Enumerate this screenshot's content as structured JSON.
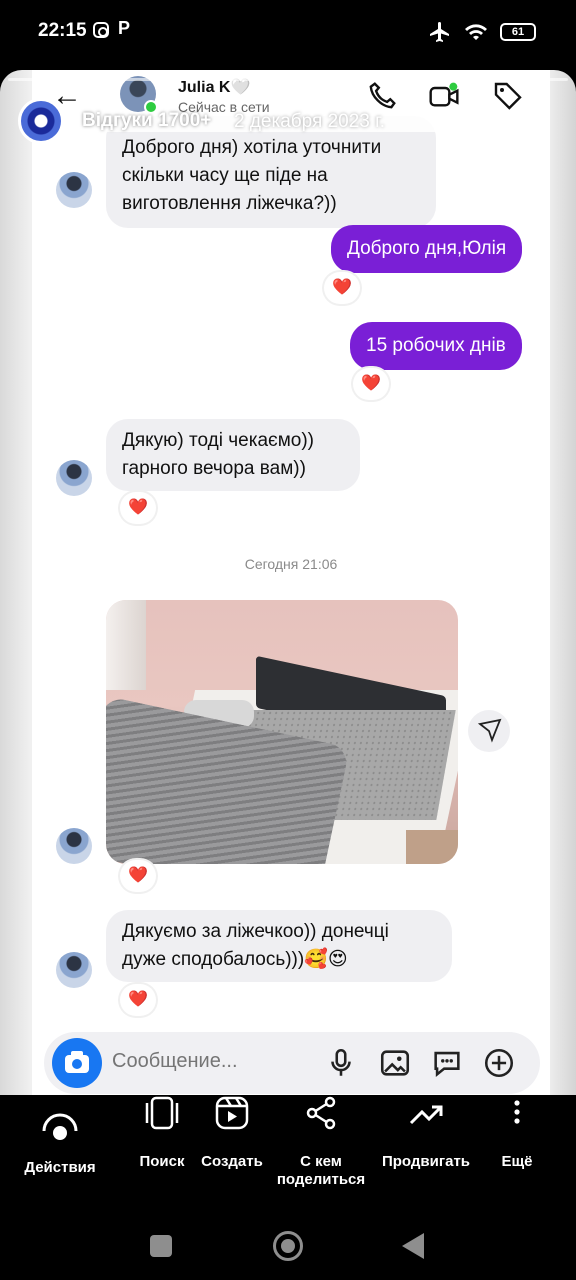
{
  "status_bar": {
    "time": "22:15",
    "battery": "61"
  },
  "story": {
    "title": "Відгуки 1700+",
    "date": "2 декабря 2023 г."
  },
  "chat": {
    "contact_name": "Julia K🤍",
    "contact_status": "Сейчас в сети",
    "messages": [
      {
        "direction": "incoming",
        "text": "Доброго дня) хотіла уточнити скільки часу ще піде на виготовлення ліжечка?))"
      },
      {
        "direction": "outgoing",
        "text": "Доброго дня,Юлія",
        "reaction": "❤️"
      },
      {
        "direction": "outgoing",
        "text": "15 робочих днів",
        "reaction": "❤️"
      },
      {
        "direction": "incoming",
        "text": "Дякую) тоді чекаємо)) гарного вечора вам))",
        "reaction": "❤️"
      },
      {
        "direction": "incoming",
        "type": "photo",
        "reaction": "❤️"
      },
      {
        "direction": "incoming",
        "text": "Дякуємо за ліжечкоо)) донечці дуже сподобалось)))🥰😍",
        "reaction": "❤️"
      }
    ],
    "timestamp": "Сегодня 21:06",
    "composer_placeholder": "Сообщение..."
  },
  "actions": [
    {
      "label": "Действия",
      "icon": "eye-icon"
    },
    {
      "label": "Поиск",
      "icon": "phone-frame-icon"
    },
    {
      "label": "Создать",
      "icon": "reels-icon"
    },
    {
      "label": "С кем поделиться",
      "icon": "share-nodes-icon"
    },
    {
      "label": "Продвигать",
      "icon": "trending-icon"
    },
    {
      "label": "Ещё",
      "icon": "more-vertical-icon"
    }
  ],
  "colors": {
    "outgoing_bubble": "#7a1fd6",
    "incoming_bubble": "#efeff2",
    "camera_button": "#1877f2",
    "online": "#2ecc40"
  }
}
